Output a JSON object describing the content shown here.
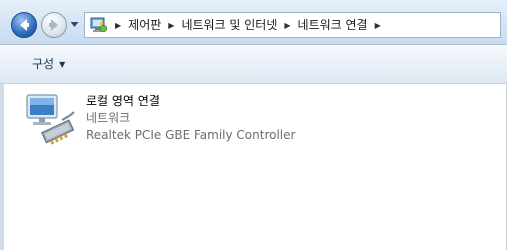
{
  "navigation": {
    "breadcrumbs": [
      {
        "label": "제어판"
      },
      {
        "label": "네트워크 및 인터넷"
      },
      {
        "label": "네트워크 연결"
      }
    ]
  },
  "toolbar": {
    "organize_label": "구성"
  },
  "connection": {
    "name": "로컬 영역 연결",
    "status": "네트워크",
    "device": "Realtek PCIe GBE Family Controller",
    "icon": "network-adapter-icon"
  },
  "colors": {
    "accent": "#2c6bbd",
    "toolbar_text": "#1e395b",
    "secondary_text": "#6d6d6d"
  }
}
